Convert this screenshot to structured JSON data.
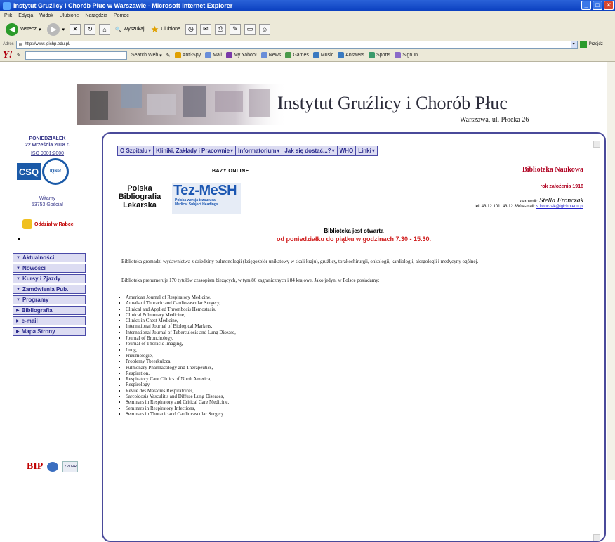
{
  "window": {
    "title": "Instytut Gruźlicy i Chorób Płuc w Warszawie - Microsoft Internet Explorer"
  },
  "menu": [
    "Plik",
    "Edycja",
    "Widok",
    "Ulubione",
    "Narzędzia",
    "Pomoc"
  ],
  "toolbar": {
    "back": "Wstecz",
    "search": "Wyszukaj",
    "favorites": "Ulubione"
  },
  "address": {
    "label": "Adres",
    "url": "http://www.igichp.edu.pl/",
    "go": "Przejdź"
  },
  "yahoo": {
    "search_web": "Search Web",
    "items": [
      "Anti-Spy",
      "Mail",
      "My Yahoo!",
      "News",
      "Games",
      "Music",
      "Answers",
      "Sports",
      "Sign In"
    ],
    "colors": {
      "logo": "#b0000f"
    }
  },
  "header": {
    "title": "Instytut Gruźlicy i Chorób Płuc",
    "address": "Warszawa, ul. Płocka 26"
  },
  "left": {
    "day": "PONIEDZIAŁEK",
    "date": "22 września 2008 r.",
    "iso": "ISO 9001:2000",
    "csq": "CSQ",
    "iqnet": "IQNet",
    "welcome": "Witamy",
    "visitors": "53753 Gościa!",
    "rabka": "Oddział w Rabce",
    "nav": [
      {
        "label": "Aktualności",
        "icon": "chevron-down"
      },
      {
        "label": "Nowości",
        "icon": "chevron-down"
      },
      {
        "label": "Kursy i Zjazdy",
        "icon": "chevron-down"
      },
      {
        "label": "Zamówienia Pub.",
        "icon": "chevron-down"
      },
      {
        "label": "Programy",
        "icon": "chevron-down"
      },
      {
        "label": "Bibliografia",
        "icon": "chevron-right"
      },
      {
        "label": "e-mail",
        "icon": "chevron-right"
      },
      {
        "label": "Mapa Strony",
        "icon": "chevron-right"
      }
    ],
    "bip": "BIP",
    "zporr": "ZPORR"
  },
  "topnav": [
    "O Szpitalu",
    "Kliniki, Zakłady i Pracownie",
    "Informatorium",
    "Jak się dostać...?",
    "WHO",
    "Linki"
  ],
  "content": {
    "bazy": "BAZY ONLINE",
    "pbl": [
      "Polska",
      "Bibliografia",
      "Lekarska"
    ],
    "tez_big": "Tez-MeSH",
    "tez_small1": "Polska wersja tezaurusa",
    "tez_small2": "Medical Subject Headings",
    "bibl_title": "Biblioteka Naukowa",
    "rok": "rok założenia 1918",
    "kier_label": "kierownik:",
    "kier_name": "Stella Fronczak",
    "kier_contact": "tel. 43 12 101, 43 12 380  e-mail:",
    "kier_mail": "s.fronczak@igichp.edu.pl",
    "open1": "Biblioteka jest otwarta",
    "open2": "od poniedziałku do piątku w godzinach 7.30 - 15.30.",
    "para1": "Biblioteka gromadzi wydawnictwa z dziedziny pulmonologii (księgozbiór unikatowy w skali kraju), gruźlicy, torakochirurgii, onkologii, kardiologii, alergologii i medycyny ogólnej.",
    "para2": "Biblioteka prenumeruje 170 tytułów czasopism bieżących, w tym 86 zagranicznych i 84 krajowe. Jako jedyni w Polsce posiadamy:",
    "journals": [
      "American Journal of Respiratory Medicine,",
      "Annals of Thoracic and Cardiovascular Surgery,",
      "Clinical and Applied Thrombosis Hemostasis,",
      "Clinical Pulmonary Medicine,",
      "Clinics in Chest Medicine,",
      "International Journal of Biological Markers,",
      "International Journal of Tuberculosis and Lung Disease,",
      "Journal of Bronchology,",
      "Journal of Thoracic Imaging,",
      "Lung,",
      "Pneumologie,",
      "Problemy Tbeerkulcza,",
      "Pulmonary Pharmacology and Therapeutics,",
      "Respiration,",
      "Respiratory Care Clinics of North America,",
      "Respirology",
      "Revue des Maladies Respiratoires,",
      "Sarcoidosis Vasculitis and Diffuse Lung Diseases,",
      "Seminars in Respiratory and Critical Care Medicine,",
      "Seminars in Respiratory Infections,",
      "Seminars in Thoracic and Cardiovascular Surgery."
    ]
  },
  "colors": {
    "nav_bg": "#dcdcf2",
    "nav_border": "#4a4aa8",
    "accent_red": "#b00020",
    "open_red": "#d02020"
  }
}
